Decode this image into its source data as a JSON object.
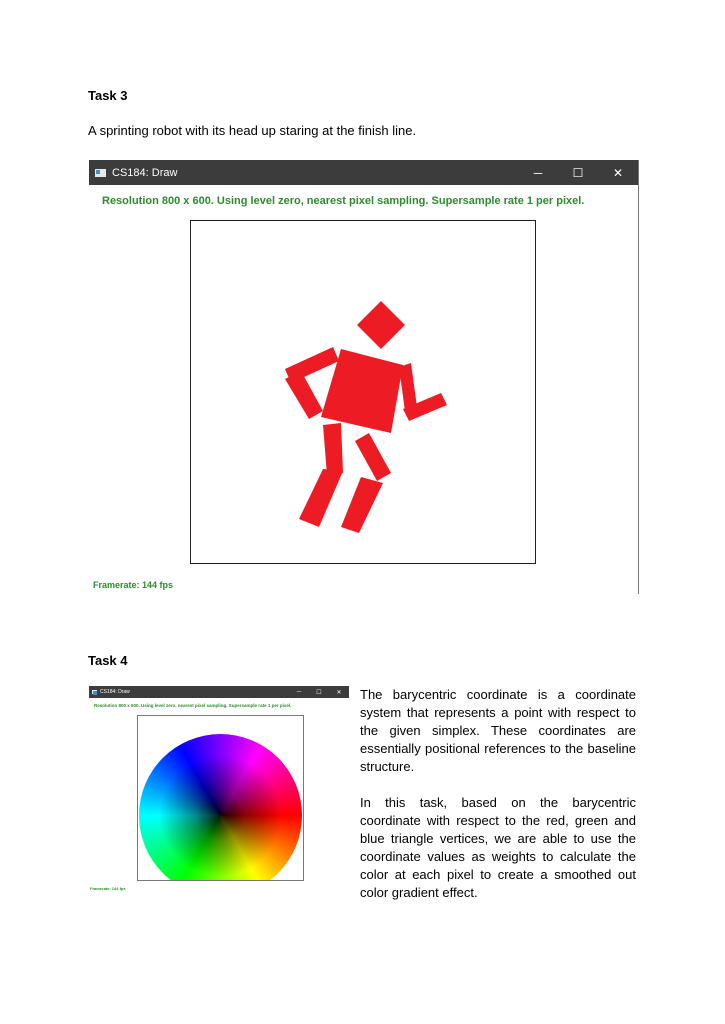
{
  "task3": {
    "heading": "Task 3",
    "description": "A sprinting robot with its head up staring at the finish line.",
    "window": {
      "title": "CS184: Draw",
      "minimize": "─",
      "maximize": "☐",
      "close": "✕",
      "status_top": "Resolution 800 x 600. Using level zero, nearest pixel sampling. Supersample rate 1 per pixel.",
      "status_bottom": "Framerate: 144 fps",
      "robot_color": "#ed1c24"
    }
  },
  "task4": {
    "heading": "Task 4",
    "window": {
      "title": "CS184: Draw",
      "minimize": "─",
      "maximize": "☐",
      "close": "✕",
      "status_top": "Resolution 800 x 600. Using level zero, nearest pixel sampling. Supersample rate 1 per pixel.",
      "status_bottom": "Framerate: 144 fps"
    },
    "paragraph1": "The barycentric coordinate is a coordinate system that represents a point with respect to the given simplex. These coordinates are essentially positional references to the baseline structure.",
    "paragraph2": "In this task, based on the barycentric coordinate with respect to the red, green and blue triangle vertices, we are able to use the coordinate values as weights to calculate the color at each pixel to create a smoothed out color gradient effect."
  },
  "colors": {
    "titlebar": "#3c3c3c",
    "status_green": "#2e8b2e"
  }
}
